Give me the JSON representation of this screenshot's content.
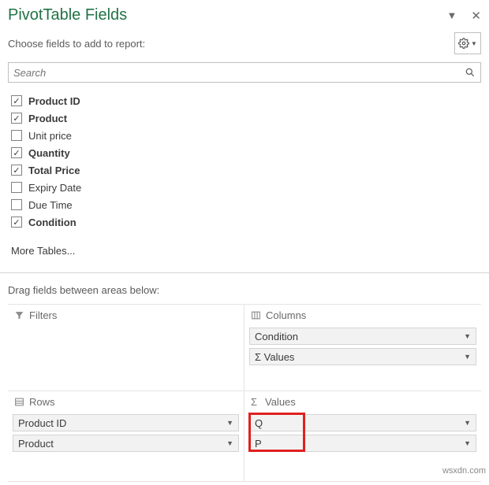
{
  "header": {
    "title": "PivotTable Fields"
  },
  "instruction": "Choose fields to add to report:",
  "search": {
    "placeholder": "Search"
  },
  "fields": [
    {
      "label": "Product ID",
      "checked": true,
      "bold": true
    },
    {
      "label": "Product",
      "checked": true,
      "bold": true
    },
    {
      "label": "Unit price",
      "checked": false,
      "bold": false
    },
    {
      "label": "Quantity",
      "checked": true,
      "bold": true
    },
    {
      "label": "Total Price",
      "checked": true,
      "bold": true
    },
    {
      "label": "Expiry Date",
      "checked": false,
      "bold": false
    },
    {
      "label": "Due Time",
      "checked": false,
      "bold": false
    },
    {
      "label": "Condition",
      "checked": true,
      "bold": true
    }
  ],
  "more_tables": "More Tables...",
  "drag_label": "Drag fields between areas below:",
  "areas": {
    "filters": {
      "title": "Filters",
      "items": []
    },
    "columns": {
      "title": "Columns",
      "items": [
        "Condition",
        "Σ  Values"
      ]
    },
    "rows": {
      "title": "Rows",
      "items": [
        "Product ID",
        "Product"
      ]
    },
    "values": {
      "title": "Values",
      "items": [
        "Q",
        "P"
      ]
    }
  },
  "watermark": "wsxdn.com"
}
